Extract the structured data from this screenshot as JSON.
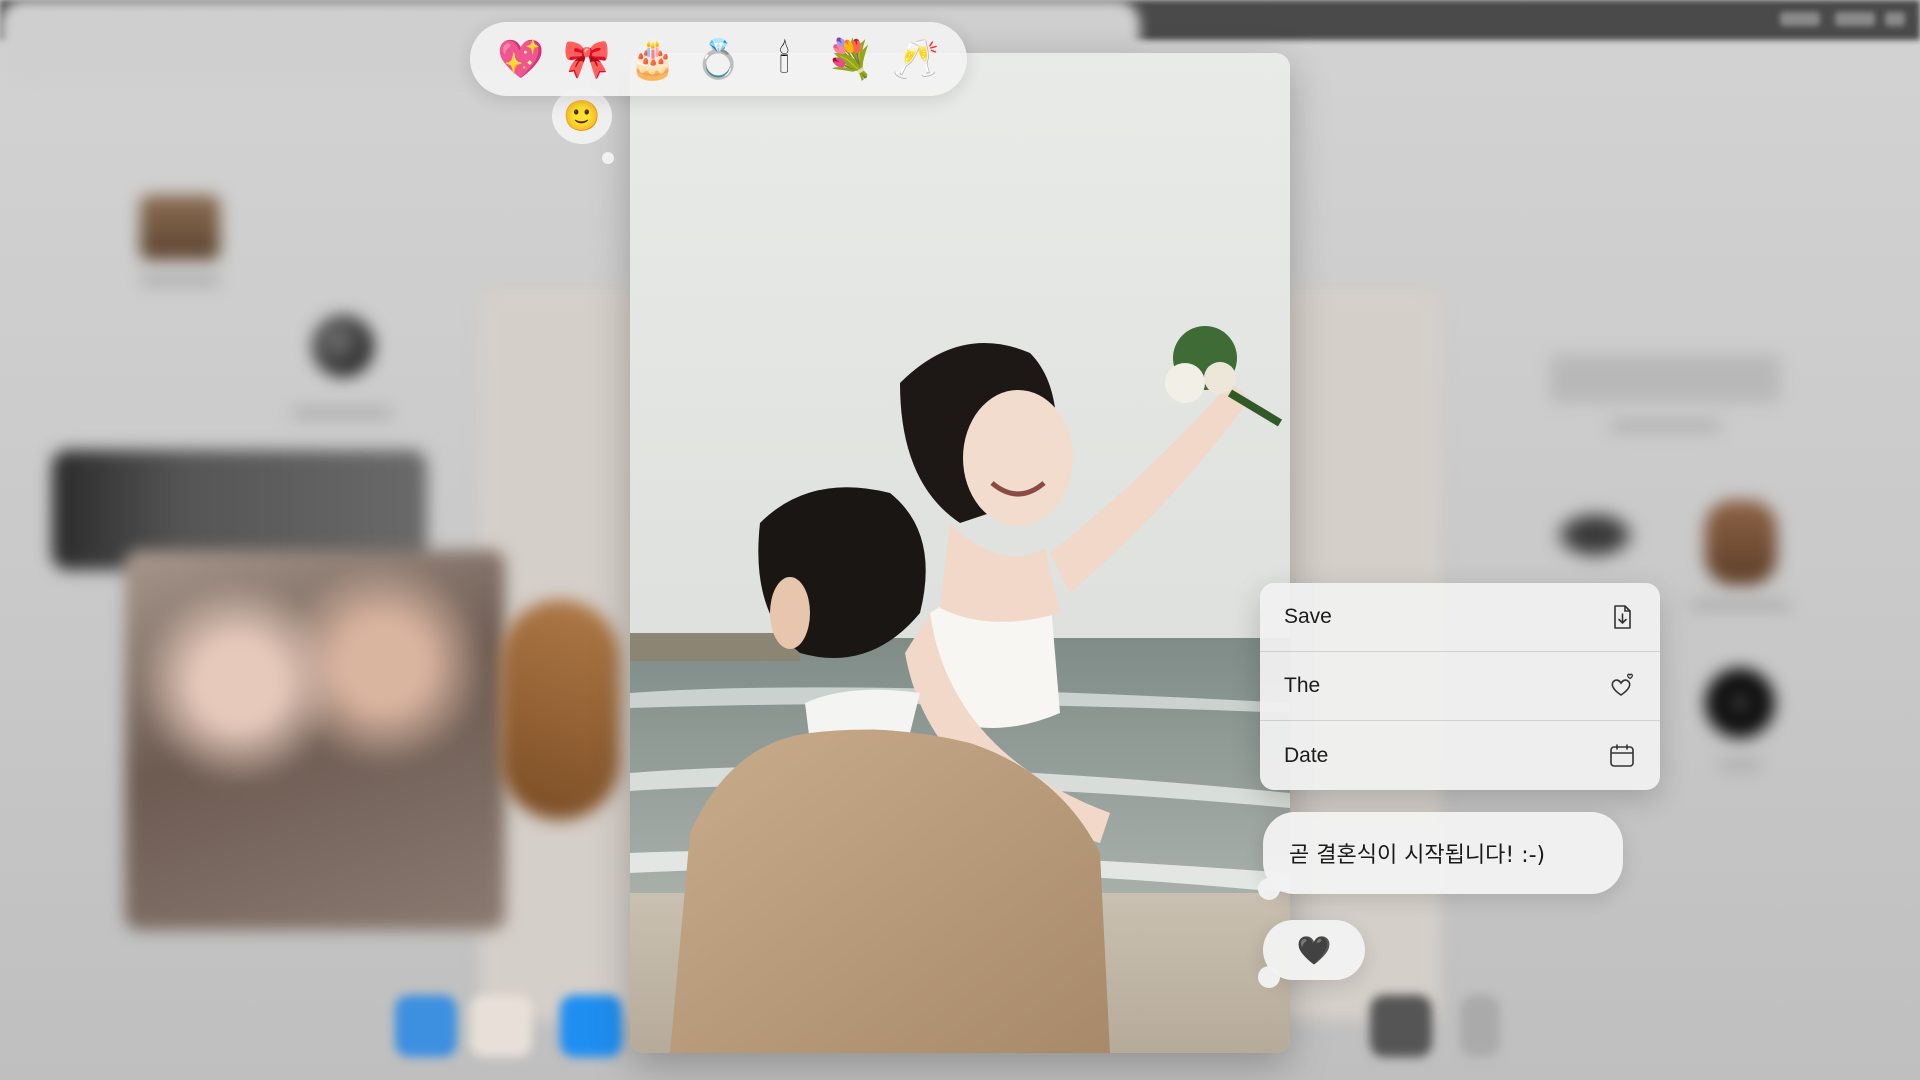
{
  "reactions": {
    "emojis": [
      {
        "name": "sparkling-heart",
        "glyph": "💖"
      },
      {
        "name": "ribbon",
        "glyph": "🎀"
      },
      {
        "name": "wedding-cake",
        "glyph": "🎂"
      },
      {
        "name": "rings",
        "glyph": "💍"
      },
      {
        "name": "candle",
        "glyph": "🕯"
      },
      {
        "name": "bouquet",
        "glyph": "💐"
      },
      {
        "name": "champagne",
        "glyph": "🥂"
      }
    ],
    "selected_glyph": "🙂"
  },
  "context_menu": {
    "items": [
      {
        "label": "Save",
        "icon": "save-file-icon"
      },
      {
        "label": "The",
        "icon": "heart-icon"
      },
      {
        "label": "Date",
        "icon": "calendar-icon"
      }
    ]
  },
  "messages": {
    "text": "곧 결혼식이 시작됩니다! :-)",
    "heart": "🖤"
  },
  "colors": {
    "menubar": "#4a4a4a",
    "bubble": "#f2f2f2",
    "menu_text": "#1c1c1c"
  }
}
